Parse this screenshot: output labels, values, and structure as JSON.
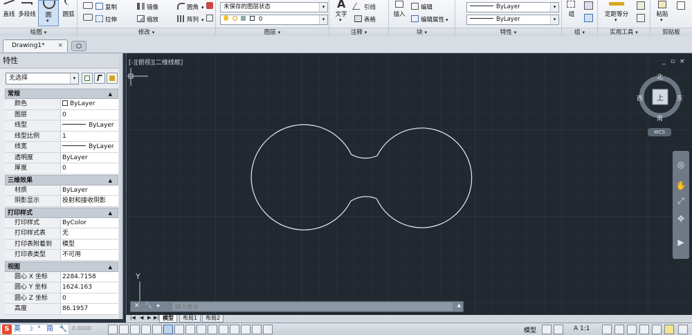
{
  "ribbon": {
    "draw": {
      "title": "绘图",
      "tools": [
        "直线",
        "多段线",
        "圆",
        "圆弧"
      ]
    },
    "modify": {
      "title": "修改",
      "tools": [
        "复制",
        "镜像",
        "圆角",
        "拉伸",
        "缩放",
        "阵列"
      ]
    },
    "layers": {
      "title": "图层",
      "layer_state": "未保存的图层状态",
      "current_layer": "0"
    },
    "annotation": {
      "title": "注释",
      "tools": [
        "文字",
        "引线",
        "表格"
      ]
    },
    "block": {
      "title": "块",
      "tools": [
        "插入",
        "编辑",
        "编辑属性"
      ]
    },
    "properties": {
      "title": "特性",
      "linetype": "ByLayer",
      "lineweight": "ByLayer"
    },
    "groups": {
      "title": "组",
      "tool": "组"
    },
    "utilities": {
      "title": "实用工具",
      "tool": "定距等分"
    },
    "clipboard": {
      "title": "剪贴板",
      "tool": "粘贴"
    }
  },
  "tabs": {
    "drawing": "Drawing1*",
    "close": "×"
  },
  "palette": {
    "title": "特性",
    "selection": "无选择",
    "categories": [
      {
        "name": "常规",
        "rows": [
          {
            "k": "颜色",
            "v": "ByLayer"
          },
          {
            "k": "图层",
            "v": "0"
          },
          {
            "k": "线型",
            "v": "ByLayer"
          },
          {
            "k": "线型比例",
            "v": "1"
          },
          {
            "k": "线宽",
            "v": "ByLayer"
          },
          {
            "k": "透明度",
            "v": "ByLayer"
          },
          {
            "k": "厚度",
            "v": "0"
          }
        ]
      },
      {
        "name": "三维效果",
        "rows": [
          {
            "k": "材质",
            "v": "ByLayer"
          },
          {
            "k": "阴影显示",
            "v": "投射和接收阴影"
          }
        ]
      },
      {
        "name": "打印样式",
        "rows": [
          {
            "k": "打印样式",
            "v": "ByColor"
          },
          {
            "k": "打印样式表",
            "v": "无"
          },
          {
            "k": "打印表附着到",
            "v": "模型"
          },
          {
            "k": "打印表类型",
            "v": "不可用"
          }
        ]
      },
      {
        "name": "视图",
        "rows": [
          {
            "k": "圆心 X 坐标",
            "v": "2284.7158"
          },
          {
            "k": "圆心 Y 坐标",
            "v": "1624.163"
          },
          {
            "k": "圆心 Z 坐标",
            "v": "0"
          },
          {
            "k": "高度",
            "v": "86.1957"
          }
        ]
      }
    ]
  },
  "viewport": {
    "label": "[-][俯视][二维线框]",
    "compass": {
      "north": "北",
      "south": "南",
      "east": "东",
      "west": "西",
      "top": "上"
    },
    "wcs": "WCS",
    "y_axis": "Y",
    "window_controls": [
      "_",
      "▫",
      "×"
    ]
  },
  "command": {
    "placeholder": "键入命令"
  },
  "layout_tabs": [
    "模型",
    "布局1",
    "布局2"
  ],
  "status": {
    "ime": {
      "brand": "S",
      "lang": "英",
      "simp": "简"
    },
    "coords": "0.0000",
    "model": "模型",
    "scale": "A 1:1"
  },
  "colors": {
    "canvas": "#212830",
    "grid_minor": "#2b333d",
    "grid_major": "#323b47",
    "geometry": "#e8ecf0",
    "ribbon": "#eef1f4",
    "active_tool": "#cfe0f3"
  }
}
